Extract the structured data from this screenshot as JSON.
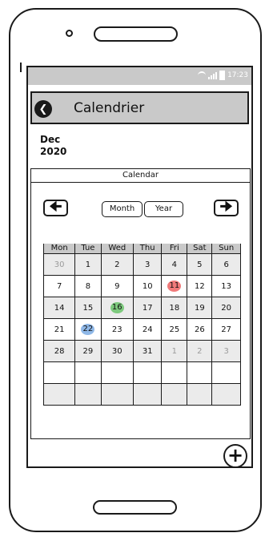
{
  "status": {
    "time": "17:23"
  },
  "appbar": {
    "title": "Calendrier"
  },
  "date": {
    "month": "Dec",
    "year": "2020"
  },
  "calendar": {
    "header": "Calendar",
    "buttons": {
      "month": "Month",
      "year": "Year"
    },
    "weekdays": [
      "Mon",
      "Tue",
      "Wed",
      "Thu",
      "Fri",
      "Sat",
      "Sun"
    ],
    "weeks": [
      [
        {
          "d": "30",
          "m": true
        },
        {
          "d": "1"
        },
        {
          "d": "2"
        },
        {
          "d": "3"
        },
        {
          "d": "4"
        },
        {
          "d": "5"
        },
        {
          "d": "6"
        }
      ],
      [
        {
          "d": "7"
        },
        {
          "d": "8"
        },
        {
          "d": "9"
        },
        {
          "d": "10"
        },
        {
          "d": "11",
          "mark": "#f07a7a"
        },
        {
          "d": "12"
        },
        {
          "d": "13"
        }
      ],
      [
        {
          "d": "14"
        },
        {
          "d": "15"
        },
        {
          "d": "16",
          "mark": "#7dc97d"
        },
        {
          "d": "17"
        },
        {
          "d": "18"
        },
        {
          "d": "19"
        },
        {
          "d": "20"
        }
      ],
      [
        {
          "d": "21"
        },
        {
          "d": "22",
          "mark": "#8fb8e8"
        },
        {
          "d": "23"
        },
        {
          "d": "24"
        },
        {
          "d": "25"
        },
        {
          "d": "26"
        },
        {
          "d": "27"
        }
      ],
      [
        {
          "d": "28"
        },
        {
          "d": "29"
        },
        {
          "d": "30"
        },
        {
          "d": "31"
        },
        {
          "d": "1",
          "m": true
        },
        {
          "d": "2",
          "m": true
        },
        {
          "d": "3",
          "m": true
        }
      ],
      [
        {
          "d": ""
        },
        {
          "d": ""
        },
        {
          "d": ""
        },
        {
          "d": ""
        },
        {
          "d": ""
        },
        {
          "d": ""
        },
        {
          "d": ""
        }
      ],
      [
        {
          "d": ""
        },
        {
          "d": ""
        },
        {
          "d": ""
        },
        {
          "d": ""
        },
        {
          "d": ""
        },
        {
          "d": ""
        },
        {
          "d": ""
        }
      ]
    ]
  },
  "icons": {
    "back": "arrow-left-circle-icon",
    "prev": "arrow-left-icon",
    "next": "arrow-right-icon",
    "add": "plus-circle-icon"
  }
}
